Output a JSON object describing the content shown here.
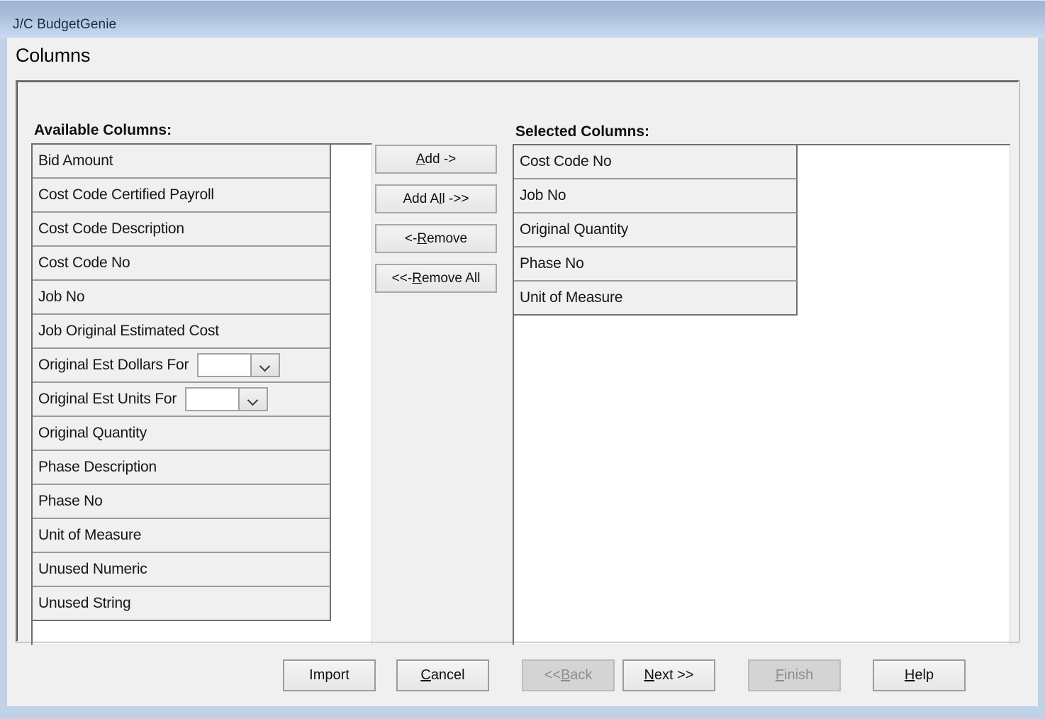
{
  "window": {
    "title": "J/C BudgetGenie",
    "heading": "Columns"
  },
  "available": {
    "heading": "Available Columns:",
    "items": [
      {
        "label": "Bid Amount"
      },
      {
        "label": "Cost Code Certified Payroll"
      },
      {
        "label": "Cost Code Description"
      },
      {
        "label": "Cost Code No"
      },
      {
        "label": "Job No"
      },
      {
        "label": "Job Original Estimated Cost"
      },
      {
        "label": "Original Est Dollars For",
        "combo": true,
        "combo_value": ""
      },
      {
        "label": "Original Est Units For",
        "combo": true,
        "combo_value": ""
      },
      {
        "label": "Original Quantity"
      },
      {
        "label": "Phase Description"
      },
      {
        "label": "Phase No"
      },
      {
        "label": "Unit of Measure"
      },
      {
        "label": "Unused Numeric"
      },
      {
        "label": "Unused String"
      }
    ]
  },
  "selected": {
    "heading": "Selected Columns:",
    "items": [
      {
        "label": "Cost Code No"
      },
      {
        "label": "Job No"
      },
      {
        "label": "Original Quantity"
      },
      {
        "label": "Phase No"
      },
      {
        "label": "Unit of Measure"
      }
    ]
  },
  "transfer_buttons": [
    {
      "name": "add",
      "pre": "",
      "accel": "A",
      "post": "dd ->",
      "enabled": true
    },
    {
      "name": "add-all",
      "pre": "Add A",
      "accel": "l",
      "post": "l ->>",
      "enabled": true
    },
    {
      "name": "remove",
      "pre": "<- ",
      "accel": "R",
      "post": "emove",
      "enabled": true
    },
    {
      "name": "remove-all",
      "pre": "<<- ",
      "accel": "R",
      "post": "emove All",
      "enabled": true
    }
  ],
  "nav_buttons": [
    {
      "name": "import",
      "pre": "Import",
      "accel": "",
      "post": "",
      "enabled": true
    },
    {
      "name": "cancel",
      "pre": "",
      "accel": "C",
      "post": "ancel",
      "enabled": true
    },
    {
      "name": "back",
      "pre": "<< ",
      "accel": "B",
      "post": "ack",
      "enabled": false
    },
    {
      "name": "next",
      "pre": "",
      "accel": "N",
      "post": "ext >>",
      "enabled": true
    },
    {
      "name": "finish",
      "pre": "",
      "accel": "F",
      "post": "inish",
      "enabled": false
    },
    {
      "name": "help",
      "pre": "",
      "accel": "H",
      "post": "elp",
      "enabled": true
    }
  ],
  "colors": {
    "title_bar_top": "#9fb5d2",
    "title_bar_bottom": "#c9daf0",
    "window_frame": "#bfd2e8",
    "dialog_face": "#f0f0f0",
    "row_face": "#f0f0f0",
    "text": "#16161e",
    "disabled_text": "#8d8d8d"
  },
  "icons": {
    "combo_dropdown": "chevron-down-icon"
  }
}
